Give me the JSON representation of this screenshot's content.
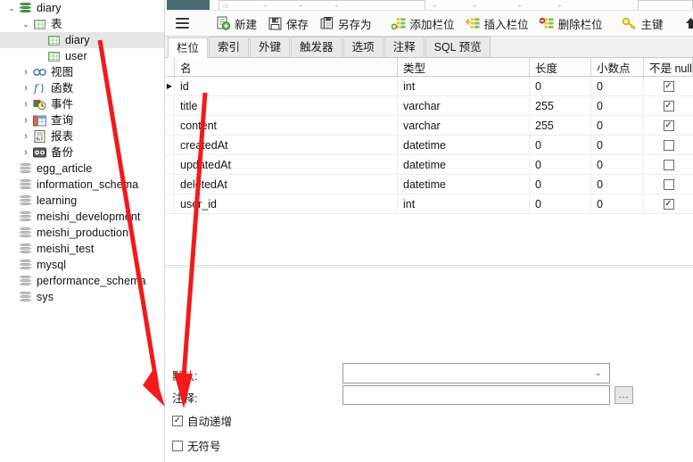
{
  "app": {
    "accent_red": "#f21a1a",
    "selection_gray": "#e6e6e6",
    "tab_active_bg": "#ffffff"
  },
  "sidebar": {
    "items": [
      {
        "label": "diary",
        "icon": "database-icon",
        "indent": 0,
        "chevron": "expanded",
        "selected": false
      },
      {
        "label": "表",
        "icon": "table-grid-icon",
        "indent": 1,
        "chevron": "expanded",
        "selected": false
      },
      {
        "label": "diary",
        "icon": "table-grid-icon",
        "indent": 2,
        "chevron": "none",
        "selected": true
      },
      {
        "label": "user",
        "icon": "table-grid-icon",
        "indent": 2,
        "chevron": "none",
        "selected": false
      },
      {
        "label": "视图",
        "icon": "view-icon",
        "indent": 1,
        "chevron": "collapsed",
        "selected": false
      },
      {
        "label": "函数",
        "icon": "function-icon",
        "indent": 1,
        "chevron": "collapsed",
        "selected": false
      },
      {
        "label": "事件",
        "icon": "event-clock-icon",
        "indent": 1,
        "chevron": "collapsed",
        "selected": false
      },
      {
        "label": "查询",
        "icon": "query-icon",
        "indent": 1,
        "chevron": "collapsed",
        "selected": false
      },
      {
        "label": "报表",
        "icon": "report-icon",
        "indent": 1,
        "chevron": "collapsed",
        "selected": false
      },
      {
        "label": "备份",
        "icon": "backup-icon",
        "indent": 1,
        "chevron": "collapsed",
        "selected": false
      },
      {
        "label": "egg_article",
        "icon": "database-grey-icon",
        "indent": 0,
        "chevron": "none",
        "selected": false
      },
      {
        "label": "information_schema",
        "icon": "database-grey-icon",
        "indent": 0,
        "chevron": "none",
        "selected": false
      },
      {
        "label": "learning",
        "icon": "database-grey-icon",
        "indent": 0,
        "chevron": "none",
        "selected": false
      },
      {
        "label": "meishi_development",
        "icon": "database-grey-icon",
        "indent": 0,
        "chevron": "none",
        "selected": false
      },
      {
        "label": "meishi_production",
        "icon": "database-grey-icon",
        "indent": 0,
        "chevron": "none",
        "selected": false
      },
      {
        "label": "meishi_test",
        "icon": "database-grey-icon",
        "indent": 0,
        "chevron": "none",
        "selected": false
      },
      {
        "label": "mysql",
        "icon": "database-grey-icon",
        "indent": 0,
        "chevron": "none",
        "selected": false
      },
      {
        "label": "performance_schema",
        "icon": "database-grey-icon",
        "indent": 0,
        "chevron": "none",
        "selected": false
      },
      {
        "label": "sys",
        "icon": "database-grey-icon",
        "indent": 0,
        "chevron": "none",
        "selected": false
      }
    ]
  },
  "toolbar": {
    "menu_icon": "hamburger-menu-icon",
    "buttons": [
      {
        "label": "新建",
        "icon": "new-document-icon"
      },
      {
        "label": "保存",
        "icon": "save-floppy-icon"
      },
      {
        "label": "另存为",
        "icon": "save-as-icon"
      },
      {
        "label": "添加栏位",
        "icon": "add-field-icon"
      },
      {
        "label": "插入栏位",
        "icon": "insert-field-icon"
      },
      {
        "label": "删除栏位",
        "icon": "delete-field-icon"
      },
      {
        "label": "主键",
        "icon": "key-icon"
      },
      {
        "label": "上",
        "icon": "move-up-arrow-icon"
      }
    ]
  },
  "tabs": [
    {
      "label": "栏位",
      "active": true
    },
    {
      "label": "索引",
      "active": false
    },
    {
      "label": "外键",
      "active": false
    },
    {
      "label": "触发器",
      "active": false
    },
    {
      "label": "选项",
      "active": false
    },
    {
      "label": "注释",
      "active": false
    },
    {
      "label": "SQL 预览",
      "active": false
    }
  ],
  "grid": {
    "columns": [
      "名",
      "类型",
      "长度",
      "小数点",
      "不是 null"
    ],
    "rows": [
      {
        "marker": "▶",
        "name": "id",
        "type": "int",
        "length": "0",
        "decimals": "0",
        "not_null": true
      },
      {
        "marker": "",
        "name": "title",
        "type": "varchar",
        "length": "255",
        "decimals": "0",
        "not_null": true
      },
      {
        "marker": "",
        "name": "content",
        "type": "varchar",
        "length": "255",
        "decimals": "0",
        "not_null": true
      },
      {
        "marker": "",
        "name": "createdAt",
        "type": "datetime",
        "length": "0",
        "decimals": "0",
        "not_null": false
      },
      {
        "marker": "",
        "name": "updatedAt",
        "type": "datetime",
        "length": "0",
        "decimals": "0",
        "not_null": false
      },
      {
        "marker": "",
        "name": "deletedAt",
        "type": "datetime",
        "length": "0",
        "decimals": "0",
        "not_null": false
      },
      {
        "marker": "",
        "name": "user_id",
        "type": "int",
        "length": "0",
        "decimals": "0",
        "not_null": true
      }
    ],
    "check_glyph": "✓"
  },
  "properties": {
    "default_label": "默认:",
    "default_value": "",
    "comment_label": "注释:",
    "comment_value": "",
    "browse_label": "...",
    "auto_increment": {
      "label": "自动递增",
      "checked": true
    },
    "unsigned": {
      "label": "无符号",
      "checked": false
    }
  }
}
